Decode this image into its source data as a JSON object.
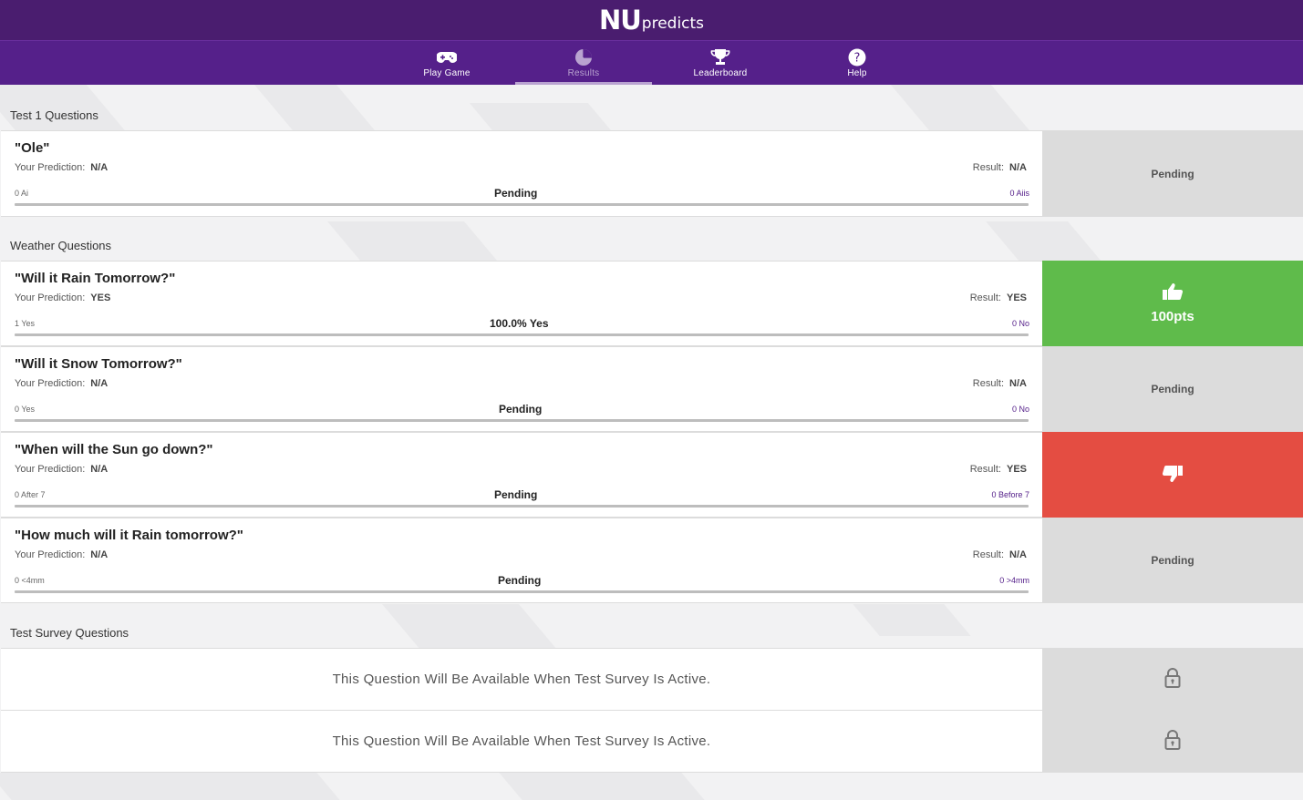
{
  "header": {
    "logo_nu": "NU",
    "logo_predicts": "predicts"
  },
  "nav": {
    "tabs": [
      {
        "label": "Play Game",
        "icon": "gamepad-icon"
      },
      {
        "label": "Results",
        "icon": "pie-chart-icon",
        "active": true
      },
      {
        "label": "Leaderboard",
        "icon": "trophy-icon"
      },
      {
        "label": "Help",
        "icon": "help-icon"
      }
    ]
  },
  "sections": {
    "test1": {
      "title": "Test 1 Questions"
    },
    "weather": {
      "title": "Weather Questions"
    },
    "survey": {
      "title": "Test Survey Questions"
    }
  },
  "labels": {
    "your_prediction": "Your Prediction:",
    "result": "Result:"
  },
  "questions": [
    {
      "title": "\"Ole\"",
      "prediction": "N/A",
      "result": "N/A",
      "left_count": "0 Ai",
      "right_count": "0 Aiis",
      "center": "Pending",
      "side": "Pending",
      "side_state": "pending"
    },
    {
      "title": "\"Will it Rain Tomorrow?\"",
      "prediction": "YES",
      "result": "YES",
      "left_count": "1 Yes",
      "right_count": "0 No",
      "center": "100.0% Yes",
      "side": "100pts",
      "side_state": "win",
      "bar_fill": 1.0
    },
    {
      "title": "\"Will it Snow Tomorrow?\"",
      "prediction": "N/A",
      "result": "N/A",
      "left_count": "0 Yes",
      "right_count": "0 No",
      "center": "Pending",
      "side": "Pending",
      "side_state": "pending"
    },
    {
      "title": "\"When will the Sun go down?\"",
      "prediction": "N/A",
      "result": "YES",
      "left_count": "0 After 7",
      "right_count": "0 Before 7",
      "center": "Pending",
      "side": "",
      "side_state": "lose"
    },
    {
      "title": "\"How much will it Rain tomorrow?\"",
      "prediction": "N/A",
      "result": "N/A",
      "left_count": "0 <4mm",
      "right_count": "0 >4mm",
      "center": "Pending",
      "side": "Pending",
      "side_state": "pending"
    }
  ],
  "locked": [
    {
      "message": "This Question Will Be Available When Test Survey Is Active."
    },
    {
      "message": "This Question Will Be Available When Test Survey Is Active."
    }
  ],
  "colors": {
    "header": "#4a1d6f",
    "nav": "#55208a",
    "win": "#5fbb4b",
    "lose": "#e44d42",
    "pending": "#dcdcdc"
  }
}
